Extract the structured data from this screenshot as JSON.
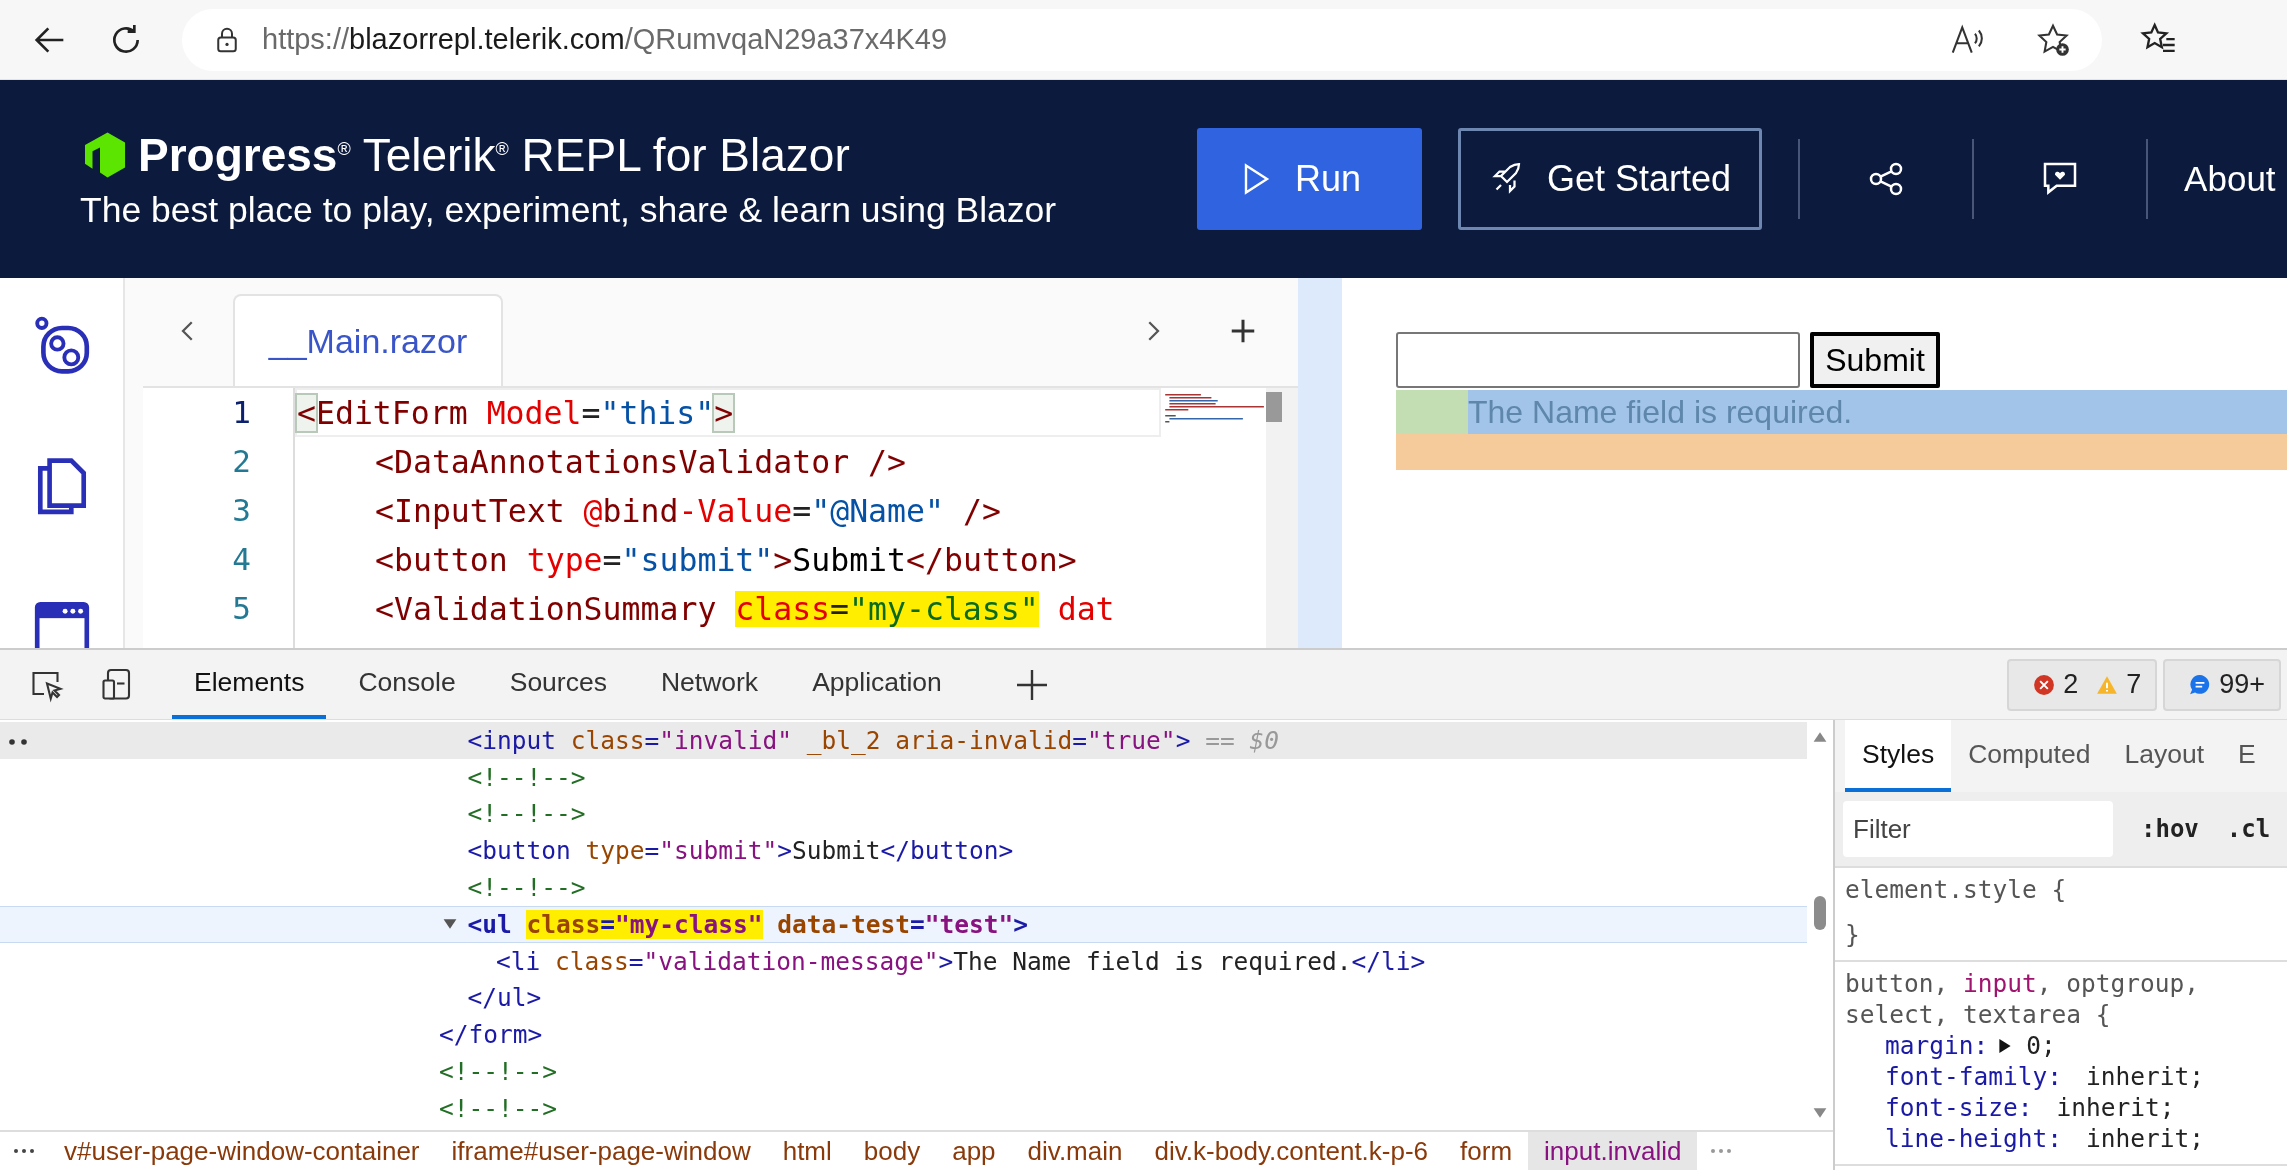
{
  "browser": {
    "url": {
      "scheme": "https://",
      "host": "blazorrepl.telerik.com",
      "path": "/QRumvqaN29a37x4K49"
    }
  },
  "header": {
    "title": "**Progress**$^{®}$ Telerik$^{®}$ REPL for Blazor",
    "tagline": "The best place to play, experiment, share & learn using Blazor",
    "actions": [
      {
        "kind": "primary",
        "label": "Run"
      },
      {
        "kind": "outline",
        "label": "Get Started"
      }
    ],
    "about": "About"
  },
  "editor": {
    "tab": "__Main.razor",
    "lines": [
      {
        "number": "1",
        "current": true,
        "indented": false,
        "segments": [
          {
            "kind": "match",
            "text": "<"
          },
          {
            "kind": "tag",
            "text": "EditForm"
          },
          {
            "kind": "attr",
            "text": " Model"
          },
          {
            "kind": "punct",
            "text": "="
          },
          {
            "kind": "str",
            "text": "\"this\""
          },
          {
            "kind": "match",
            "text": ">"
          }
        ]
      },
      {
        "number": "2",
        "current": false,
        "indented": true,
        "segments": [
          {
            "kind": "tag",
            "text": "<DataAnnotationsValidator"
          },
          {
            "kind": "tag",
            "text": " />"
          }
        ]
      },
      {
        "number": "3",
        "current": false,
        "indented": true,
        "segments": [
          {
            "kind": "tag",
            "text": "<InputText"
          },
          {
            "kind": "attr",
            "text": " @"
          },
          {
            "kind": "tag",
            "text": "bind"
          },
          {
            "kind": "attr",
            "text": "-Value"
          },
          {
            "kind": "punct",
            "text": "="
          },
          {
            "kind": "str",
            "text": "\"@Name\""
          },
          {
            "kind": "tag",
            "text": " />"
          }
        ]
      },
      {
        "number": "4",
        "current": false,
        "indented": true,
        "segments": [
          {
            "kind": "tag",
            "text": "<button"
          },
          {
            "kind": "attr",
            "text": " type"
          },
          {
            "kind": "punct",
            "text": "="
          },
          {
            "kind": "str",
            "text": "\"submit\""
          },
          {
            "kind": "tag",
            "text": ">"
          },
          {
            "kind": "plain",
            "text": "Submit"
          },
          {
            "kind": "tag",
            "text": "</button>"
          }
        ]
      },
      {
        "number": "5",
        "current": false,
        "indented": true,
        "segments": [
          {
            "kind": "tag",
            "text": "<ValidationSummary"
          },
          {
            "kind": "mark",
            "parts": [
              {
                "kind": "attr",
                "text": "class"
              },
              {
                "kind": "punct",
                "text": "="
              },
              {
                "kind": "mstr",
                "text": "\"my-class\""
              }
            ]
          },
          {
            "kind": "attr",
            "text": " dat"
          }
        ]
      }
    ]
  },
  "preview": {
    "submit": "Submit",
    "message": "The Name field is required."
  },
  "devtools": {
    "tabs": [
      {
        "label": "Elements",
        "selected": true
      },
      {
        "label": "Console",
        "selected": false
      },
      {
        "label": "Sources",
        "selected": false
      },
      {
        "label": "Network",
        "selected": false
      },
      {
        "label": "Application",
        "selected": false
      }
    ],
    "errors": "2",
    "warnings": "7",
    "issues": "99+",
    "dom": [
      {
        "closing": "</form>",
        "children": [
          {
            "selected": true,
            "hovered": false,
            "segments": [
              {
                "kind": "tag",
                "text": "<input"
              },
              {
                "kind": "attr",
                "text": " class"
              },
              {
                "kind": "tag",
                "text": "="
              },
              {
                "kind": "val",
                "text": "\"invalid\""
              },
              {
                "kind": "attr",
                "text": " _bl_2"
              },
              {
                "kind": "attr",
                "text": " aria-invalid"
              },
              {
                "kind": "tag",
                "text": "="
              },
              {
                "kind": "val",
                "text": "\"true\""
              },
              {
                "kind": "tag",
                "text": ">"
              },
              {
                "kind": "dim",
                "text": " == $0"
              }
            ]
          },
          {
            "selected": false,
            "hovered": false,
            "segments": [
              {
                "kind": "comment",
                "text": "<!--!-->"
              }
            ]
          },
          {
            "selected": false,
            "hovered": false,
            "segments": [
              {
                "kind": "comment",
                "text": "<!--!-->"
              }
            ]
          },
          {
            "selected": false,
            "hovered": false,
            "segments": [
              {
                "kind": "tag",
                "text": "<button"
              },
              {
                "kind": "attr",
                "text": " type"
              },
              {
                "kind": "tag",
                "text": "="
              },
              {
                "kind": "val",
                "text": "\"submit\""
              },
              {
                "kind": "tag",
                "text": ">"
              },
              {
                "kind": "plain",
                "text": "Submit"
              },
              {
                "kind": "tag",
                "text": "</button>"
              }
            ]
          },
          {
            "selected": false,
            "hovered": false,
            "segments": [
              {
                "kind": "comment",
                "text": "<!--!-->"
              }
            ]
          },
          {
            "selected": false,
            "hovered": true,
            "expanded": true,
            "closing": "</ul>",
            "segments": [
              {
                "kind": "tag",
                "text": "<ul"
              },
              {
                "kind": "mark",
                "parts": [
                  {
                    "kind": "attr",
                    "text": "class"
                  },
                  {
                    "kind": "tag",
                    "text": "="
                  },
                  {
                    "kind": "val",
                    "text": "\"my-class\""
                  }
                ]
              },
              {
                "kind": "attr",
                "text": " data-test"
              },
              {
                "kind": "tag",
                "text": "="
              },
              {
                "kind": "val",
                "text": "\"test\""
              },
              {
                "kind": "tag",
                "text": ">"
              }
            ],
            "children": [
              {
                "selected": false,
                "hovered": false,
                "segments": [
                  {
                    "kind": "tag",
                    "text": "<li"
                  },
                  {
                    "kind": "attr",
                    "text": " class"
                  },
                  {
                    "kind": "tag",
                    "text": "="
                  },
                  {
                    "kind": "val",
                    "text": "\"validation-message\""
                  },
                  {
                    "kind": "tag",
                    "text": ">"
                  },
                  {
                    "kind": "plain",
                    "text": "The Name field is required."
                  },
                  {
                    "kind": "tag",
                    "text": "</li>"
                  }
                ]
              }
            ]
          }
        ]
      },
      {
        "selected": false,
        "hovered": false,
        "segments": [
          {
            "kind": "comment",
            "text": "<!--!-->"
          }
        ]
      },
      {
        "selected": false,
        "hovered": false,
        "segments": [
          {
            "kind": "comment",
            "text": "<!--!-->"
          }
        ]
      }
    ],
    "breadcrumbs": [
      {
        "label": "v#user-page-window-container",
        "selected": false
      },
      {
        "label": "iframe#user-page-window",
        "selected": false
      },
      {
        "label": "html",
        "selected": false
      },
      {
        "label": "body",
        "selected": false
      },
      {
        "label": "app",
        "selected": false
      },
      {
        "label": "div.main",
        "selected": false
      },
      {
        "label": "div.k-body.content.k-p-6",
        "selected": false
      },
      {
        "label": "form",
        "selected": false
      },
      {
        "label": "input.invalid",
        "selected": true
      }
    ],
    "styles": {
      "tabs": [
        {
          "label": "Styles",
          "selected": true
        },
        {
          "label": "Computed",
          "selected": false
        },
        {
          "label": "Layout",
          "selected": false
        },
        {
          "label": "E",
          "selected": false
        }
      ],
      "filter_placeholder": "Filter",
      "hov": ":hov",
      "cls": ".cl",
      "rules": [
        {
          "selector": [
            {
              "text": "element.style {",
              "matched": false
            }
          ],
          "closing": "}"
        },
        {
          "selector": [
            {
              "text": "button, ",
              "matched": false
            },
            {
              "text": "input",
              "matched": true
            },
            {
              "text": ", optgroup, select, textarea {",
              "matched": false
            }
          ],
          "declarations": [
            {
              "property": "margin:",
              "value": "0;",
              "expandable": true
            },
            {
              "property": "font-family:",
              "value": "inherit;",
              "expandable": false
            },
            {
              "property": "font-size:",
              "value": "inherit;",
              "expandable": false
            },
            {
              "property": "line-height:",
              "value": "inherit;",
              "expandable": false
            }
          ]
        }
      ]
    }
  }
}
